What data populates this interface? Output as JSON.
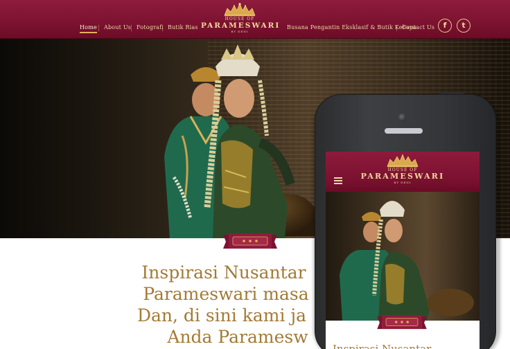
{
  "nav": {
    "items": [
      "Home",
      "About Us",
      "Fotografi",
      "Butik Rias"
    ],
    "right_items": [
      "Busana Pengantin Eksklasif & Butik Kebaya",
      "Contact Us"
    ],
    "active": "Home"
  },
  "brand": {
    "line1": "HOUSE OF",
    "line2": "PARAMESWARI",
    "line3": "BY DENI"
  },
  "social": {
    "facebook": "f",
    "twitter": "t"
  },
  "headline": {
    "line1": "Inspirasi Nusantar",
    "line2": "Parameswari masa",
    "line3": "Dan, di sini kami ja",
    "line4": "Anda Paramesw"
  },
  "colors": {
    "maroon": "#7c1230",
    "gold": "#a37a35",
    "cream": "#f2d89a"
  },
  "icons": [
    "crown-logo-icon",
    "facebook-icon",
    "twitter-icon",
    "hamburger-menu-icon",
    "ribbon-tab-icon"
  ]
}
